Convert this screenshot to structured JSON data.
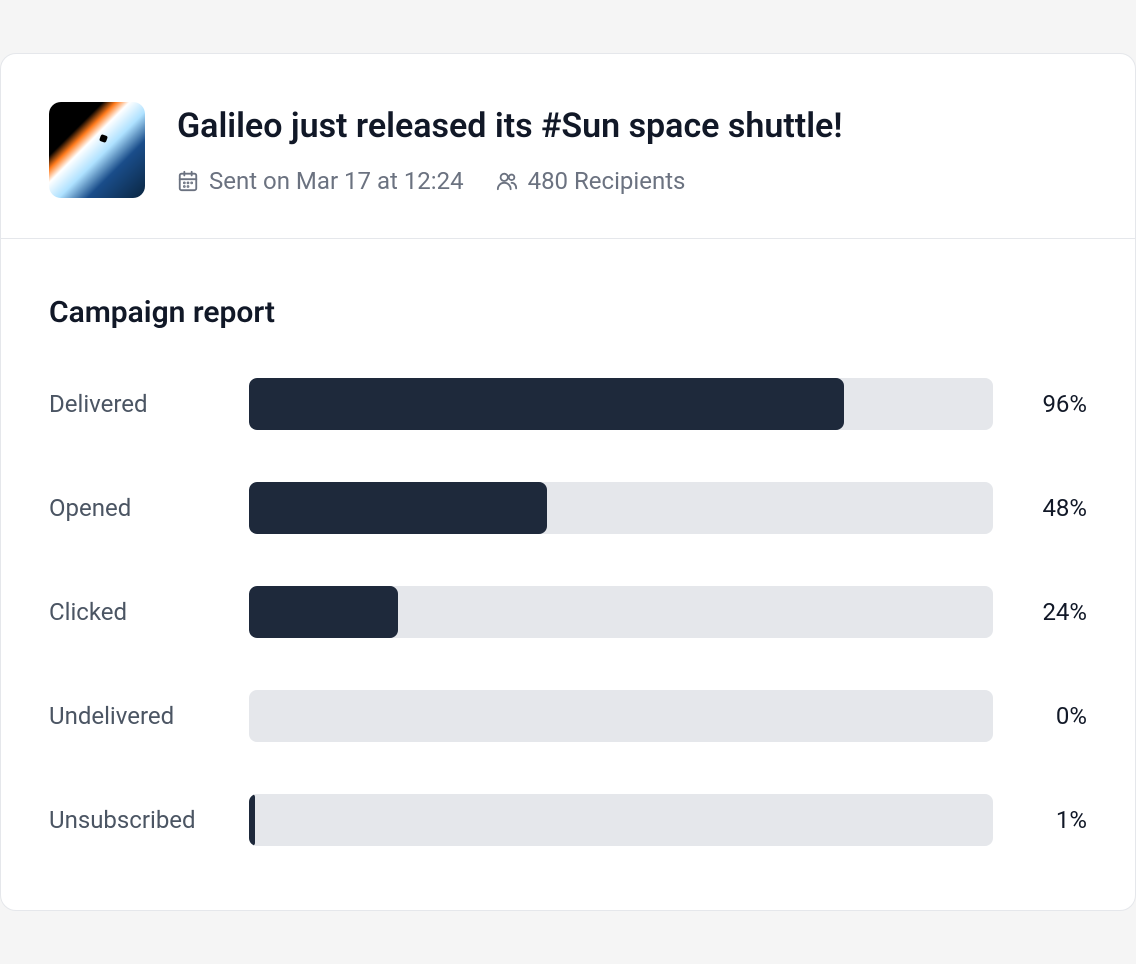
{
  "header": {
    "title": "Galileo just released its #Sun space shuttle!",
    "sent_text": "Sent on Mar 17 at 12:24",
    "recipients_text": "480 Recipients"
  },
  "report": {
    "title": "Campaign report"
  },
  "chart_data": {
    "type": "bar",
    "title": "Campaign report",
    "categories": [
      "Delivered",
      "Opened",
      "Clicked",
      "Undelivered",
      "Unsubscribed"
    ],
    "values": [
      96,
      48,
      24,
      0,
      1
    ],
    "unit": "%",
    "x_range": [
      0,
      120
    ],
    "bar_color": "#1e293b",
    "track_color": "#e5e7eb",
    "series": [
      {
        "label": "Delivered",
        "value": 96,
        "display": "96%"
      },
      {
        "label": "Opened",
        "value": 48,
        "display": "48%"
      },
      {
        "label": "Clicked",
        "value": 24,
        "display": "24%"
      },
      {
        "label": "Undelivered",
        "value": 0,
        "display": "0%"
      },
      {
        "label": "Unsubscribed",
        "value": 1,
        "display": "1%"
      }
    ]
  }
}
